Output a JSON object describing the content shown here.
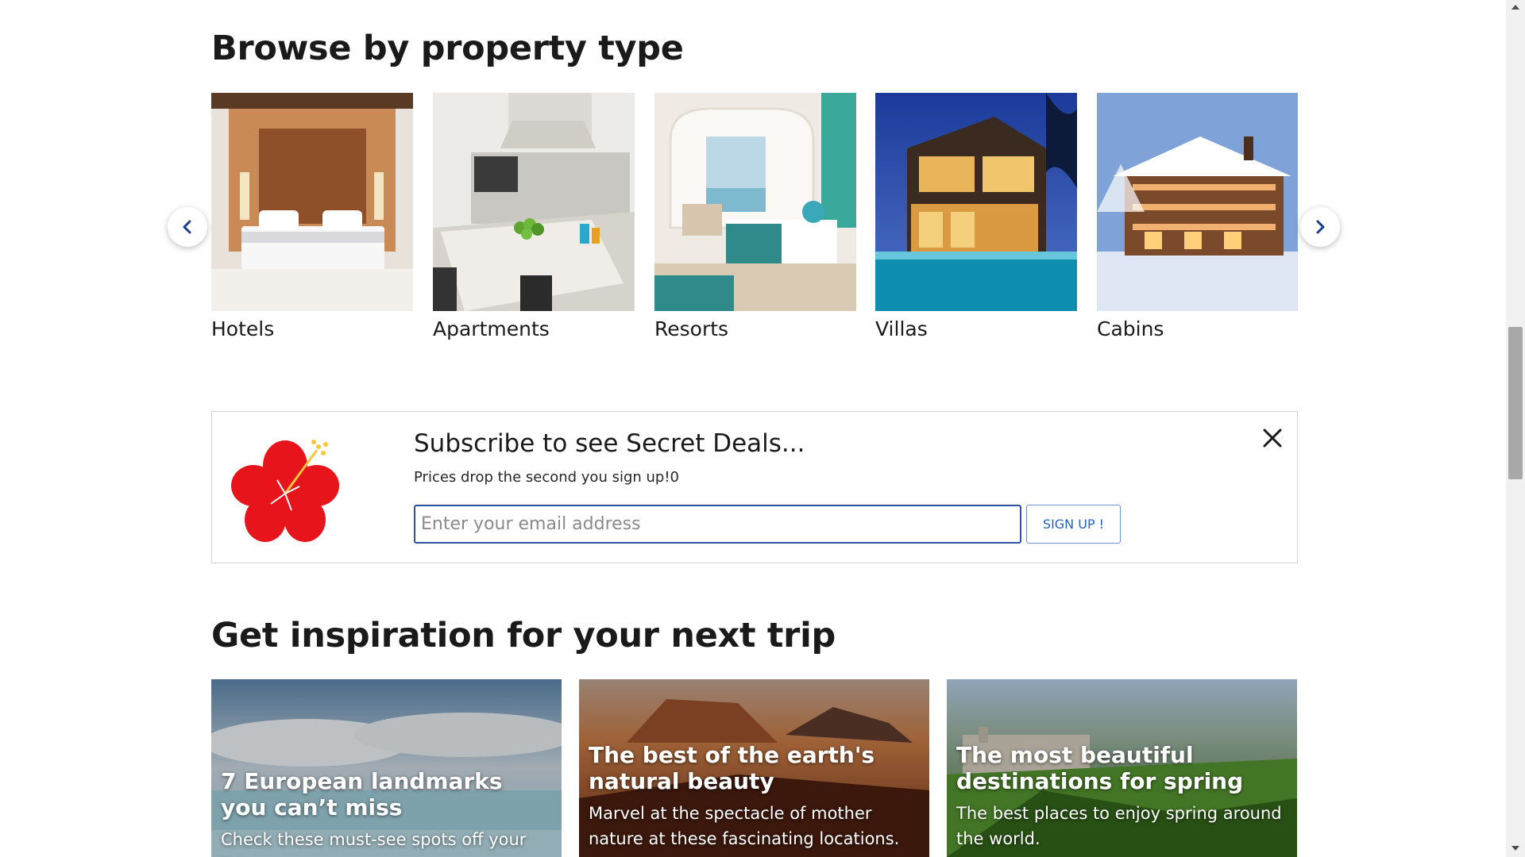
{
  "property_section": {
    "title": "Browse by property type",
    "items": [
      {
        "label": "Hotels"
      },
      {
        "label": "Apartments"
      },
      {
        "label": "Resorts"
      },
      {
        "label": "Villas"
      },
      {
        "label": "Cabins"
      }
    ],
    "prev_icon": "chevron-left-icon",
    "next_icon": "chevron-right-icon"
  },
  "subscribe": {
    "title": "Subscribe to see Secret Deals...",
    "subtitle": "Prices drop the second you sign up!0",
    "email_placeholder": "Enter your email address",
    "button_label": "SIGN UP !",
    "close_icon": "close-icon",
    "logo_icon": "hibiscus-flower-icon"
  },
  "inspiration_section": {
    "title": "Get inspiration for your next trip",
    "cards": [
      {
        "title": "7 European landmarks you can’t miss",
        "subtitle": "Check these must-see spots off your list."
      },
      {
        "title": "The best of the earth's natural beauty",
        "subtitle": "Marvel at the spectacle of mother nature at these fascinating locations."
      },
      {
        "title": "The most beautiful destinations for spring",
        "subtitle": "The best places to enjoy spring around the world."
      }
    ]
  },
  "colors": {
    "accent_blue": "#2561c4",
    "input_border": "#2f4fa0",
    "flower_red": "#e8141c"
  }
}
